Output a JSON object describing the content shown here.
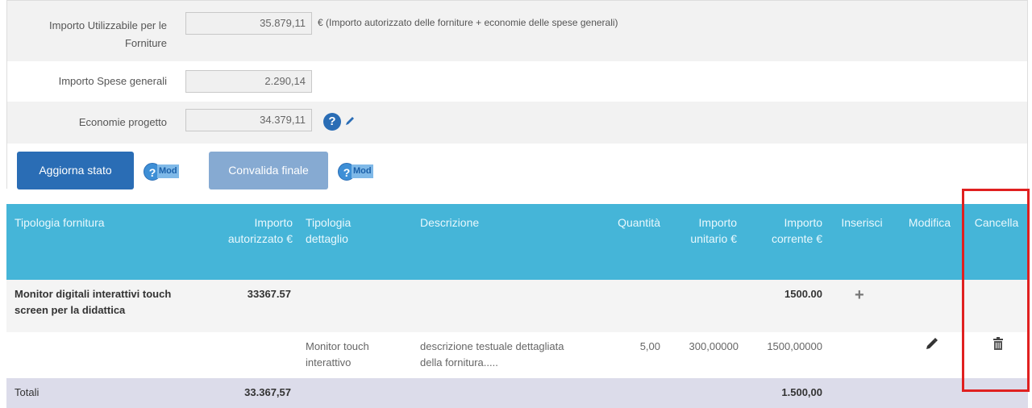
{
  "form": {
    "fields": [
      {
        "label": "Importo Utilizzabile per le Forniture",
        "value": "35.879,11",
        "note": "€ (Importo autorizzato delle forniture + economie delle spese generali)"
      },
      {
        "label": "Importo Spese generali",
        "value": "2.290,14"
      },
      {
        "label": "Economie progetto",
        "value": "34.379,11"
      }
    ],
    "help_glyph": "?"
  },
  "buttons": {
    "update_state": "Aggiorna stato",
    "final_validation": "Convalida finale",
    "mod_tag": "Mod",
    "help_glyph": "?"
  },
  "table": {
    "headers": {
      "tipologia_fornitura": "Tipologia fornitura",
      "importo_autorizzato": "Importo autorizzato €",
      "tipologia_dettaglio": "Tipologia dettaglio",
      "descrizione": "Descrizione",
      "quantita": "Quantità",
      "importo_unitario": "Importo unitario €",
      "importo_corrente": "Importo corrente €",
      "inserisci": "Inserisci",
      "modifica": "Modifica",
      "cancella": "Cancella"
    },
    "group_row": {
      "tipologia": "Monitor digitali interattivi touch screen per la didattica",
      "importo_autorizzato": "33367.57",
      "importo_corrente": "1500.00",
      "insert_glyph": "+"
    },
    "detail_row": {
      "tipologia_dettaglio": "Monitor touch interattivo",
      "descrizione": "descrizione testuale dettagliata della fornitura.....",
      "quantita": "5,00",
      "importo_unitario": "300,00000",
      "importo_corrente": "1500,00000"
    },
    "totals_row": {
      "label": "Totali",
      "importo_autorizzato": "33.367,57",
      "importo_corrente": "1.500,00"
    }
  },
  "colors": {
    "primary_button": "#2a6db5",
    "disabled_button": "#86aad2",
    "table_header": "#45b5d8",
    "highlight_border": "#e02020",
    "totals_background": "#dcdcea"
  }
}
